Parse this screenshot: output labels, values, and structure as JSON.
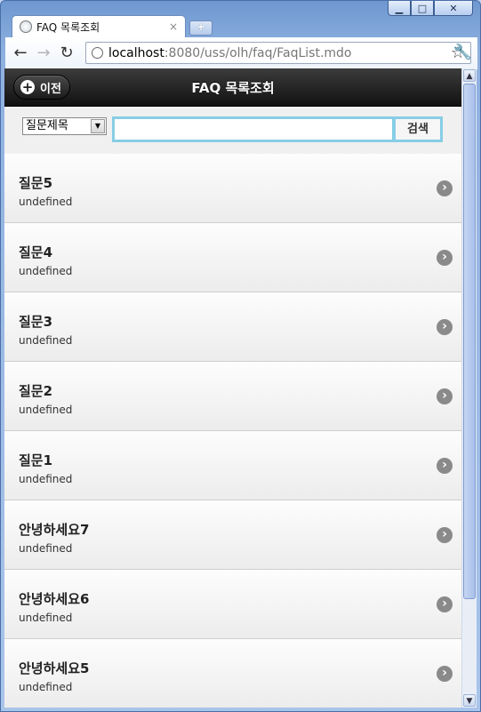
{
  "browser": {
    "tab_title": "FAQ 목록조회",
    "tab_close": "×",
    "new_tab": "+",
    "url_host": "localhost",
    "url_path": ":8080/uss/olh/faq/FaqList.mdo",
    "win_min": "▁",
    "win_max": "□",
    "win_close": "✕"
  },
  "header": {
    "back_label": "이전",
    "title": "FAQ 목록조회"
  },
  "search": {
    "select_value": "질문제목",
    "input_value": "",
    "button_label": "검색"
  },
  "items": [
    {
      "title": "질문5",
      "sub": "undefined"
    },
    {
      "title": "질문4",
      "sub": "undefined"
    },
    {
      "title": "질문3",
      "sub": "undefined"
    },
    {
      "title": "질문2",
      "sub": "undefined"
    },
    {
      "title": "질문1",
      "sub": "undefined"
    },
    {
      "title": "안녕하세요7",
      "sub": "undefined"
    },
    {
      "title": "안녕하세요6",
      "sub": "undefined"
    },
    {
      "title": "안녕하세요5",
      "sub": "undefined"
    }
  ]
}
